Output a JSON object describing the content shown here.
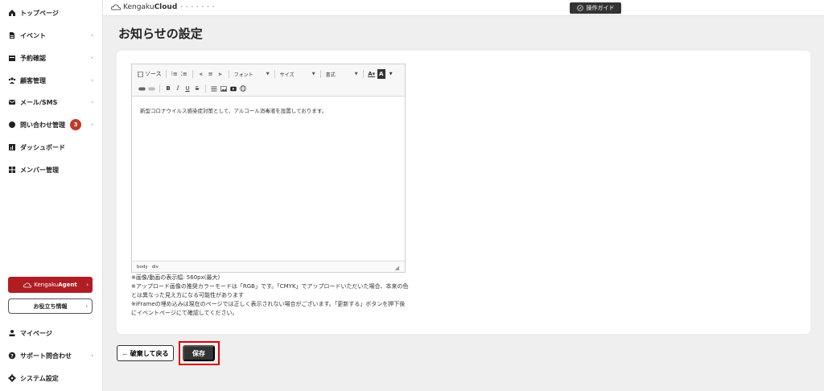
{
  "sidebar": {
    "items": [
      {
        "label": "トップページ",
        "icon": "home-icon",
        "chevron": false
      },
      {
        "label": "イベント",
        "icon": "document-icon",
        "chevron": true
      },
      {
        "label": "予約確認",
        "icon": "calendar-icon",
        "chevron": true
      },
      {
        "label": "顧客管理",
        "icon": "users-icon",
        "chevron": true
      },
      {
        "label": "メール/SMS",
        "icon": "mail-icon",
        "chevron": true
      },
      {
        "label": "問い合わせ管理",
        "icon": "chat-icon",
        "chevron": true,
        "badge": "3"
      },
      {
        "label": "ダッシュボード",
        "icon": "chart-icon",
        "chevron": false
      },
      {
        "label": "メンバー管理",
        "icon": "grid-icon",
        "chevron": false
      }
    ],
    "agent_button": {
      "logo_text": "Kengaku",
      "logo_bold": "Agent"
    },
    "useful_info_label": "お役立ち情報",
    "bottom_items": [
      {
        "label": "マイページ",
        "icon": "user-icon",
        "chevron": false
      },
      {
        "label": "サポート問合わせ",
        "icon": "help-icon",
        "chevron": true
      },
      {
        "label": "システム設定",
        "icon": "gear-icon",
        "chevron": false
      }
    ]
  },
  "topbar": {
    "brand_regular": "Kengaku",
    "brand_bold": "Cloud",
    "brand_tagline": "• • • • • • •",
    "guide_label": "操作ガイド"
  },
  "page": {
    "title": "お知らせの設定"
  },
  "editor": {
    "toolbar": {
      "source_label": "ソース",
      "font_label": "フォント",
      "size_label": "サイズ",
      "format_label": "書式"
    },
    "content": "新型コロナウイルス感染症対策として、アルコール消毒液を設置しております。",
    "status_path": [
      "body",
      "div"
    ]
  },
  "notes": [
    "※画像/動画の表示幅: 560px(最大)",
    "※アップロード画像の推奨カラーモードは「RGB」です。「CMYK」でアップロードいただいた場合、本来の色とは異なった見え方になる可能性があります",
    "※iFrameの埋め込みは現在のページでは正しく表示されない場合がございます。「更新する」ボタンを押下後にイベントページにて確認してください。"
  ],
  "actions": {
    "back_label": "← 破棄して戻る",
    "save_label": "保存"
  },
  "colors": {
    "accent_dark": "#333333",
    "agent_red": "#b01e23",
    "badge_red": "#c0392b",
    "highlight_red": "#e00000"
  }
}
